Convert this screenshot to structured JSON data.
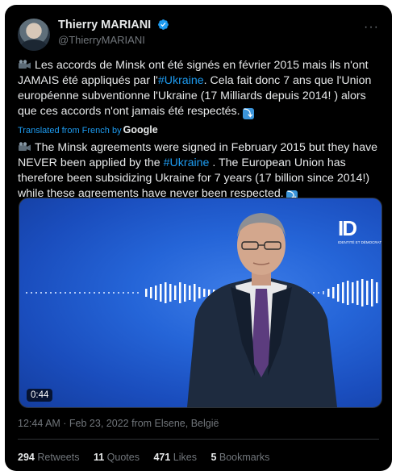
{
  "author": {
    "display_name": "Thierry MARIANI",
    "handle": "@ThierryMARIANI",
    "verified_icon": "verified-badge-icon",
    "more_icon": "more-options-icon",
    "more_glyph": "···"
  },
  "tweet": {
    "french_before": "Les accords de Minsk ont été signés en février 2015 mais ils n'ont JAMAIS été appliqués par l'",
    "french_hashtag": "#Ukraine",
    "french_after": ". Cela fait donc 7 ans que l'Union européenne subventionne l'Ukraine (17 Milliards depuis 2014! ) alors que ces accords n'ont jamais été respectés.",
    "translated_label": "Translated from French by",
    "translator": "Google",
    "english_before": "The Minsk agreements were signed in February 2015 but they have NEVER been applied by the",
    "english_hashtag": "#Ukraine",
    "english_after": ". The European Union has therefore been subsidizing Ukraine for 7 years (17 billion since 2014!) while these agreements have never been respected."
  },
  "media": {
    "duration": "0:44",
    "logo_text": "ID",
    "logo_sub": "IDENTITÉ ET DÉMOCRATIE"
  },
  "meta": {
    "timestamp": "12:44 AM · Feb 23, 2022 from Elsene, België"
  },
  "stats": {
    "retweets_count": "294",
    "retweets_label": "Retweets",
    "quotes_count": "11",
    "quotes_label": "Quotes",
    "likes_count": "471",
    "likes_label": "Likes",
    "bookmarks_count": "5",
    "bookmarks_label": "Bookmarks"
  },
  "colors": {
    "background": "#000000",
    "text": "#e7e9ea",
    "muted": "#71767b",
    "link": "#1d9bf0",
    "media_blue": "#2565d8"
  }
}
